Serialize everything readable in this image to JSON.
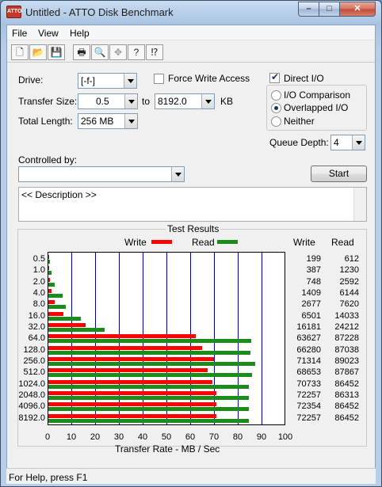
{
  "window": {
    "title": "Untitled - ATTO Disk Benchmark",
    "icon_label": "ATTO"
  },
  "captions": {
    "minimize": "–",
    "maximize": "□",
    "close": "✕"
  },
  "menu": [
    "File",
    "View",
    "Help"
  ],
  "toolbar": {
    "new": "🗋",
    "open": "📂",
    "save": "💾",
    "print": "🖶",
    "preview": "🔍",
    "move": "✥",
    "help": "?",
    "context_help": "⁉"
  },
  "form": {
    "drive_label": "Drive:",
    "drive_value": "[-f-]",
    "force_write_label": "Force Write Access",
    "direct_io_label": "Direct I/O",
    "transfer_size_label": "Transfer Size:",
    "transfer_from": "0.5",
    "to_label": "to",
    "transfer_to": "8192.0",
    "kb_label": "KB",
    "total_length_label": "Total Length:",
    "total_length_value": "256 MB",
    "io_comparison_label": "I/O Comparison",
    "overlapped_io_label": "Overlapped I/O",
    "neither_label": "Neither",
    "queue_depth_label": "Queue Depth:",
    "queue_depth_value": "4",
    "controlled_by_label": "Controlled by:",
    "controlled_by_value": "",
    "start_label": "Start",
    "description_text": "<< Description >>"
  },
  "results": {
    "title": "Test Results",
    "legend_write": "Write",
    "legend_read": "Read",
    "col_write": "Write",
    "col_read": "Read",
    "xlabel": "Transfer Rate - MB / Sec"
  },
  "colors": {
    "write": "#ff0000",
    "read": "#1a8c1a",
    "grid": "#0000aa"
  },
  "chart_data": {
    "type": "bar",
    "orientation": "horizontal",
    "xlabel": "Transfer Rate - MB / Sec",
    "xlim": [
      0,
      100
    ],
    "xticks": [
      0,
      10,
      20,
      30,
      40,
      50,
      60,
      70,
      80,
      90,
      100
    ],
    "categories": [
      "0.5",
      "1.0",
      "2.0",
      "4.0",
      "8.0",
      "16.0",
      "32.0",
      "64.0",
      "128.0",
      "256.0",
      "512.0",
      "1024.0",
      "2048.0",
      "4096.0",
      "8192.0"
    ],
    "series": [
      {
        "name": "Write",
        "values_kb": [
          199,
          387,
          748,
          1409,
          2677,
          6501,
          16181,
          63627,
          66280,
          71314,
          68653,
          70733,
          72257,
          72354,
          72257
        ]
      },
      {
        "name": "Read",
        "values_kb": [
          612,
          1230,
          2592,
          6144,
          7620,
          14033,
          24212,
          87228,
          87038,
          89023,
          87867,
          86452,
          86313,
          86452,
          86452
        ]
      }
    ]
  },
  "status": "For Help, press F1"
}
